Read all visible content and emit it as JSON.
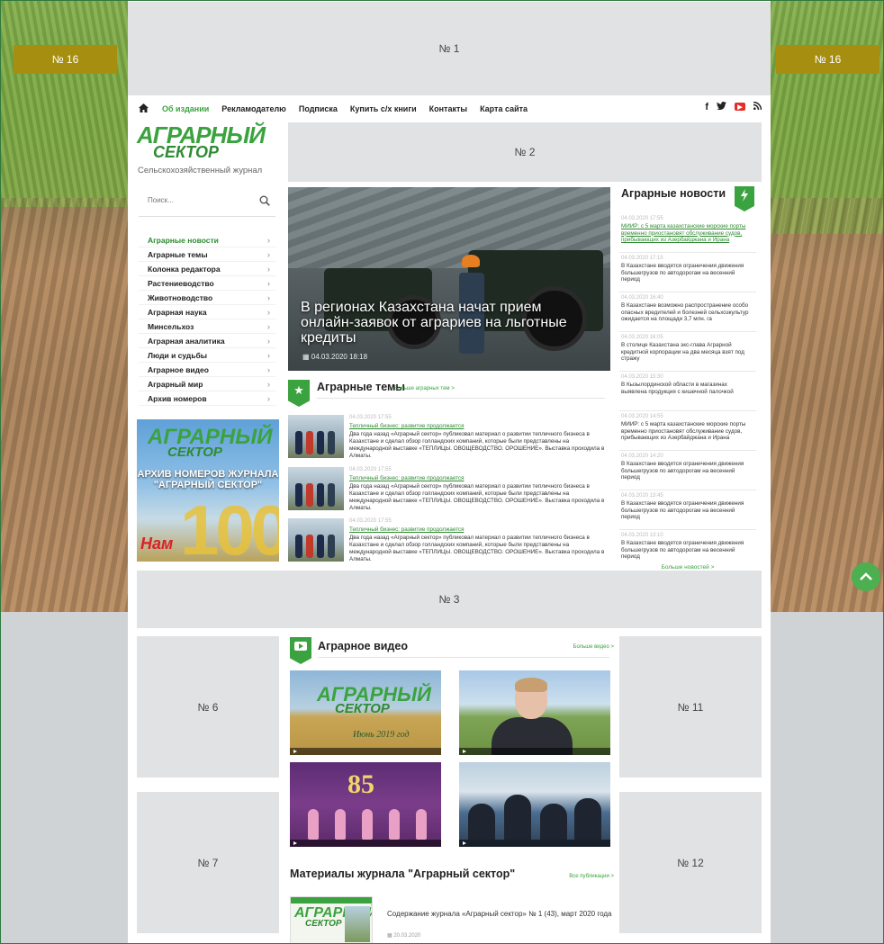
{
  "ads": {
    "side_left": "№ 16",
    "side_right": "№ 16",
    "top": "№ 1",
    "header": "№ 2",
    "middle": "№ 3",
    "left_1": "№ 6",
    "left_2": "№ 7",
    "right_1": "№ 11",
    "right_2": "№ 12"
  },
  "nav": {
    "items": [
      "Об издании",
      "Рекламодателю",
      "Подписка",
      "Купить с/х книги",
      "Контакты",
      "Карта сайта"
    ]
  },
  "logo": {
    "line1": "АГРАРНЫЙ",
    "line2": "СЕКТОР",
    "tagline": "Сельскохозяйственный журнал"
  },
  "search": {
    "placeholder": "Поиск..."
  },
  "menu": {
    "items": [
      "Аграрные новости",
      "Аграрные темы",
      "Колонка редактора",
      "Растениеводство",
      "Животноводство",
      "Аграрная наука",
      "Минсельхоз",
      "Аграрная аналитика",
      "Люди и судьбы",
      "Аграрное видео",
      "Аграрный мир",
      "Архив номеров"
    ]
  },
  "archive_banner": {
    "line1": "АГРАРНЫЙ",
    "line2": "СЕКТОР",
    "text": "АРХИВ НОМЕРОВ ЖУРНАЛА \"АГРАРНЫЙ СЕКТОР\"",
    "number": "100",
    "nam": "Нам"
  },
  "hero": {
    "title": "В регионах Казахстана начат прием онлайн-заявок от аграриев на льготные кредиты",
    "date": "04.03.2020 18:18"
  },
  "news": {
    "title": "Аграрные новости",
    "more": "Больше новостей >",
    "items": [
      {
        "date": "04.03.2020 17:55",
        "text": "МИИР: с 5 марта казахстанские морские порты временно приостановят обслуживание судов, прибывающих из Азербайджана и Ирана"
      },
      {
        "date": "04.03.2020 17:15",
        "text": "В Казахстане вводятся ограничения движения большегрузов по автодорогам на весенний период"
      },
      {
        "date": "04.03.2020 16:40",
        "text": "В Казахстане возможно распространение особо опасных вредителей и болезней сельхозкультур ожидается на площади 3,7 млн. га"
      },
      {
        "date": "04.03.2020 16:05",
        "text": "В столице Казахстана экс-глава Аграрной кредитной корпорации на два месяца взят под стражу"
      },
      {
        "date": "04.03.2020 15:30",
        "text": "В Кызылординской области в магазинах выявлена продукция с кишечной палочкой"
      },
      {
        "date": "04.03.2020 14:55",
        "text": "МИИР: с 5 марта казахстанские морские порты временно приостановят обслуживание судов, прибывающих из Азербайджана и Ирана"
      },
      {
        "date": "04.03.2020 14:20",
        "text": "В Казахстане вводятся ограничения движения большегрузов по автодорогам на весенний период"
      },
      {
        "date": "04.03.2020 13:45",
        "text": "В Казахстане вводятся ограничения движения большегрузов по автодорогам на весенний период"
      },
      {
        "date": "04.03.2020 13:10",
        "text": "В Казахстане вводятся ограничения движения большегрузов по автодорогам на весенний период"
      }
    ]
  },
  "themes": {
    "title": "Аграрные темы",
    "more": "Больше аграрных тем >",
    "items": [
      {
        "date": "04.03.2020 17:55",
        "title": "Тепличный бизнес: развитие продолжается",
        "text": "Два года назад «Аграрный сектор» публиковал материал о развитии тепличного бизнеса в Казахстане и сделал обзор голландских компаний, которые были представлены на международной выставке «ТЕПЛИЦЫ. ОВОЩЕВОДСТВО. ОРОШЕНИЕ». Выставка проходила в Алматы."
      },
      {
        "date": "04.03.2020 17:55",
        "title": "Тепличный бизнес: развитие продолжается",
        "text": "Два года назад «Аграрный сектор» публиковал материал о развитии тепличного бизнеса в Казахстане и сделал обзор голландских компаний, которые были представлены на международной выставке «ТЕПЛИЦЫ. ОВОЩЕВОДСТВО. ОРОШЕНИЕ». Выставка проходила в Алматы."
      },
      {
        "date": "04.03.2020 17:55",
        "title": "Тепличный бизнес: развитие продолжается",
        "text": "Два года назад «Аграрный сектор» публиковал материал о развитии тепличного бизнеса в Казахстане и сделал обзор голландских компаний, которые были представлены на международной выставке «ТЕПЛИЦЫ. ОВОЩЕВОДСТВО. ОРОШЕНИЕ». Выставка проходила в Алматы."
      }
    ]
  },
  "video": {
    "title": "Аграрное видео",
    "more": "Больше видео >",
    "v1_caption": "Июнь 2019 год",
    "v1_line1": "АГРАРНЫЙ",
    "v1_line2": "СЕКТОР",
    "v3_number": "85"
  },
  "materials": {
    "title": "Материалы журнала \"Аграрный сектор\"",
    "more": "Все публикации >",
    "cover_line1": "АГРАРНЫЙ",
    "cover_line2": "СЕКТОР",
    "item_title": "Содержание журнала «Аграрный сектор» № 1 (43), март 2020 года",
    "item_date": "20.03.2020"
  },
  "colors": {
    "brand_green": "#3aa33f",
    "side_banner": "#a68f10",
    "ad_placeholder": "#e0e2e4"
  }
}
